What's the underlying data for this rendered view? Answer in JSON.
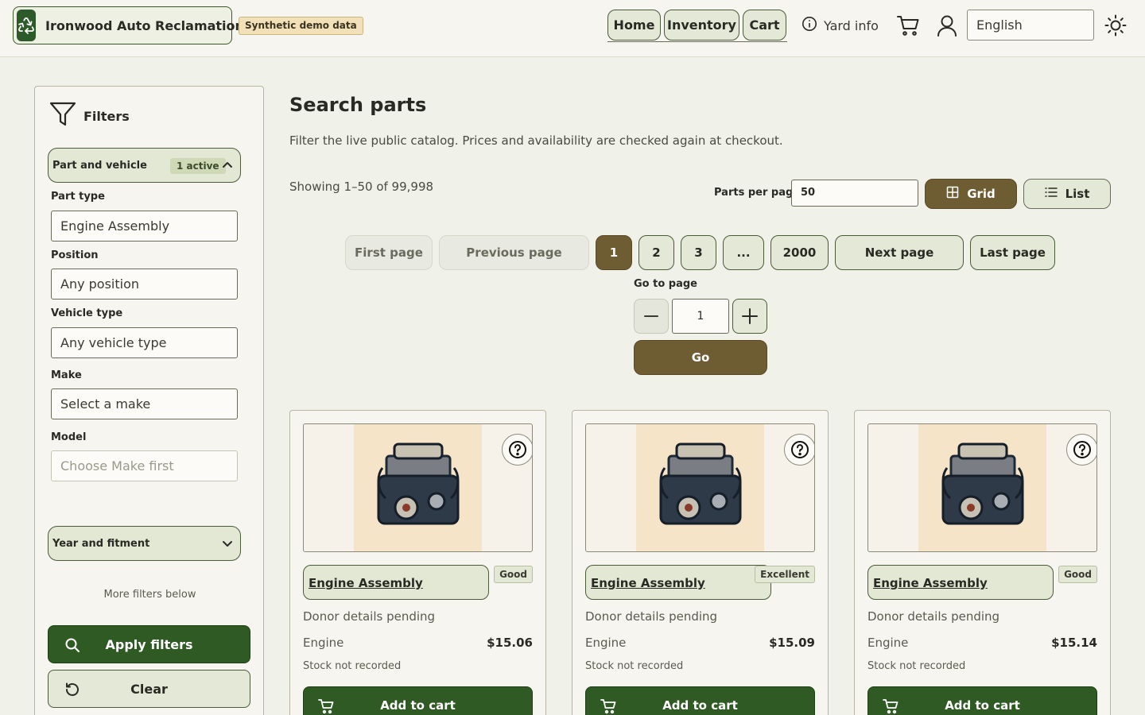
{
  "header": {
    "brand_name": "Ironwood Auto Reclamation",
    "demo_badge": "Synthetic demo data",
    "nav": [
      "Home",
      "Inventory",
      "Cart"
    ],
    "yard_info": "Yard info",
    "language": "English"
  },
  "sidebar": {
    "title": "Filters",
    "section_part_vehicle": "Part and vehicle",
    "active_badge": "1 active",
    "fields": [
      {
        "label": "Part type",
        "value": "Engine Assembly"
      },
      {
        "label": "Position",
        "value": "Any position"
      },
      {
        "label": "Vehicle type",
        "value": "Any vehicle type"
      },
      {
        "label": "Make",
        "value": "Select a make"
      },
      {
        "label": "Model",
        "value": "Choose Make first"
      }
    ],
    "section_year": "Year and fitment",
    "more_filters": "More filters below",
    "apply": "Apply filters",
    "clear": "Clear"
  },
  "main": {
    "title": "Search parts",
    "subtitle": "Filter the live public catalog. Prices and availability are checked again at checkout.",
    "showing": "Showing 1–50 of 99,998",
    "per_page_label": "Parts per page",
    "per_page_value": "50",
    "view_grid": "Grid",
    "view_list": "List"
  },
  "pagination": {
    "first": "First page",
    "previous": "Previous page",
    "pages": [
      "1",
      "2",
      "3",
      "...",
      "2000"
    ],
    "next": "Next page",
    "last": "Last page",
    "goto_label": "Go to page",
    "goto_value": "1",
    "go": "Go"
  },
  "cards": [
    {
      "name": "Engine Assembly",
      "condition": "Good",
      "donor": "Donor details pending",
      "category": "Engine",
      "price": "$15.06",
      "stock": "Stock not recorded",
      "cta": "Add to cart"
    },
    {
      "name": "Engine Assembly",
      "condition": "Excellent",
      "donor": "Donor details pending",
      "category": "Engine",
      "price": "$15.09",
      "stock": "Stock not recorded",
      "cta": "Add to cart"
    },
    {
      "name": "Engine Assembly",
      "condition": "Good",
      "donor": "Donor details pending",
      "category": "Engine",
      "price": "$15.14",
      "stock": "Stock not recorded",
      "cta": "Add to cart"
    }
  ],
  "colors": {
    "primary_green": "#2f5a24",
    "accent_brown": "#6e5c32",
    "soft_green": "#e2e8d4"
  }
}
